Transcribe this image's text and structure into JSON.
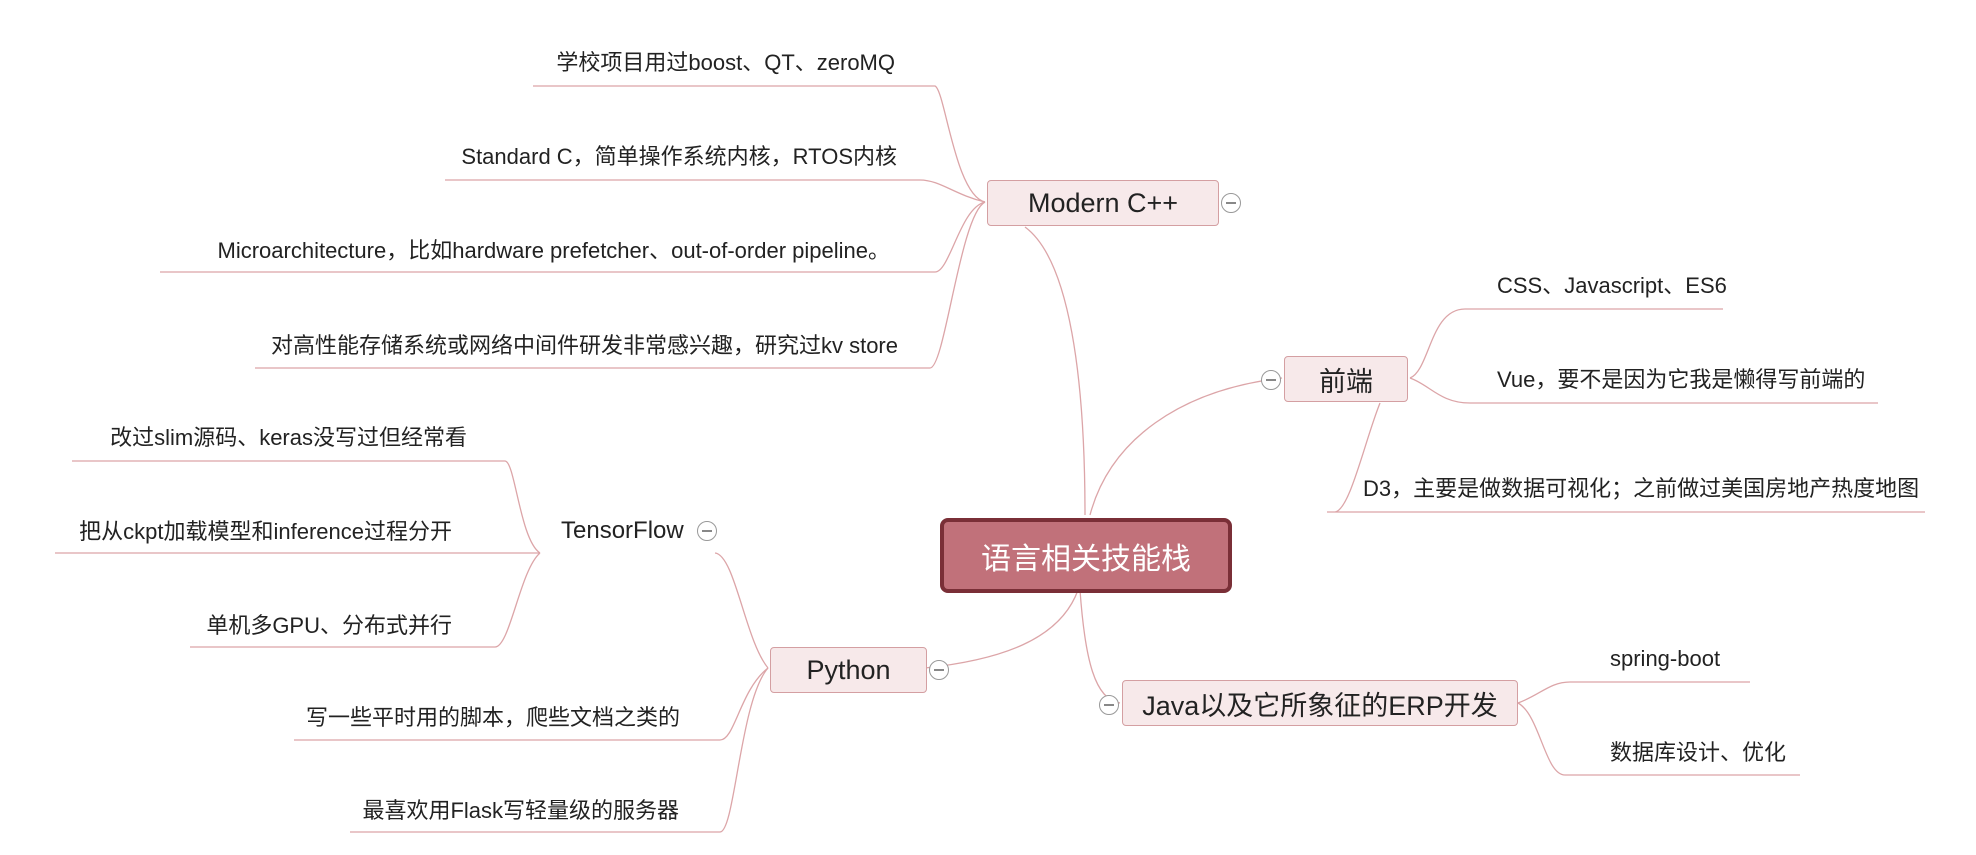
{
  "central": "语言相关技能栈",
  "branches": {
    "cpp": {
      "label": "Modern C++",
      "children": [
        "学校项目用过boost、QT、zeroMQ",
        "Standard C，简单操作系统内核，RTOS内核",
        "Microarchitecture，比如hardware prefetcher、out-of-order pipeline。",
        "对高性能存储系统或网络中间件研发非常感兴趣，研究过kv store"
      ]
    },
    "frontend": {
      "label": "前端",
      "children": [
        "CSS、Javascript、ES6",
        "Vue，要不是因为它我是懒得写前端的",
        "D3，主要是做数据可视化；之前做过美国房地产热度地图"
      ]
    },
    "python": {
      "label": "Python",
      "tensorflow": {
        "label": "TensorFlow",
        "children": [
          "改过slim源码、keras没写过但经常看",
          "把从ckpt加载模型和inference过程分开",
          "单机多GPU、分布式并行"
        ]
      },
      "children": [
        "写一些平时用的脚本，爬些文档之类的",
        "最喜欢用Flask写轻量级的服务器"
      ]
    },
    "java": {
      "label": "Java以及它所象征的ERP开发",
      "children": [
        "spring-boot",
        "数据库设计、优化"
      ]
    }
  },
  "colors": {
    "central_fill": "#c1717a",
    "central_border": "#7a2f37",
    "topic_fill": "#f7e9ea",
    "topic_border": "#d49fa2",
    "link": "#dca5a8"
  }
}
